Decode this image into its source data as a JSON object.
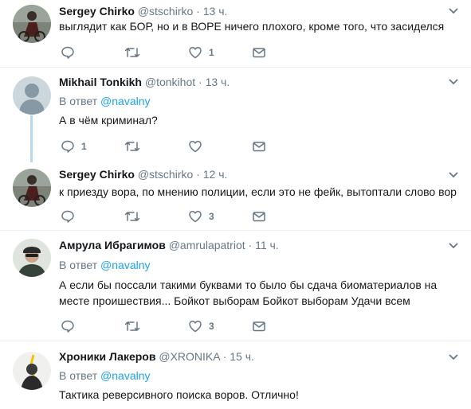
{
  "colors": {
    "accent": "#1da1f2",
    "muted": "#657786",
    "text": "#14171a",
    "thread": "#b6d8f2"
  },
  "icons": {
    "reply": "reply-icon",
    "retweet": "retweet-icon",
    "like": "heart-icon",
    "dm": "envelope-icon",
    "menu": "chevron-down-icon"
  },
  "tweets": [
    {
      "name": "Sergey Chirko",
      "handle": "@stschirko",
      "sep": "·",
      "time": "13 ч.",
      "text": "выглядит как БОР, но и в ВОРЕ ничего плохого, кроме того, что засиделся",
      "counts": {
        "reply": "",
        "retweet": "",
        "like": "1"
      }
    },
    {
      "name": "Mikhail Tonkikh",
      "handle": "@tonkihot",
      "sep": "·",
      "time": "13 ч.",
      "reply_prefix": "В ответ",
      "reply_to": "@navalny",
      "text": "А в чём криминал?",
      "counts": {
        "reply": "1",
        "retweet": "",
        "like": ""
      }
    },
    {
      "name": "Sergey Chirko",
      "handle": "@stschirko",
      "sep": "·",
      "time": "12 ч.",
      "text": "к приезду вора, по мнению полиции, если это не фейк, вытоптали слово вор",
      "counts": {
        "reply": "",
        "retweet": "",
        "like": "3"
      }
    },
    {
      "name": "Амрула Ибрагимов",
      "handle": "@amrulapatriot",
      "sep": "·",
      "time": "11 ч.",
      "reply_prefix": "В ответ",
      "reply_to": "@navalny",
      "text": "А если бы поссали такими буквами то было бы сдача биоматериалов на месте проишествия... Бойкот выборам Бойкот выборам Удачи всем",
      "counts": {
        "reply": "",
        "retweet": "",
        "like": "3"
      }
    },
    {
      "name": "Хроники Лакеров",
      "handle": "@XRONIKA",
      "sep": "·",
      "time": "15 ч.",
      "reply_prefix": "В ответ",
      "reply_to": "@navalny",
      "text": "Тактика реверсивного поиска воров. Отлично!",
      "counts": {
        "reply": "",
        "retweet": "",
        "like": ""
      }
    }
  ]
}
